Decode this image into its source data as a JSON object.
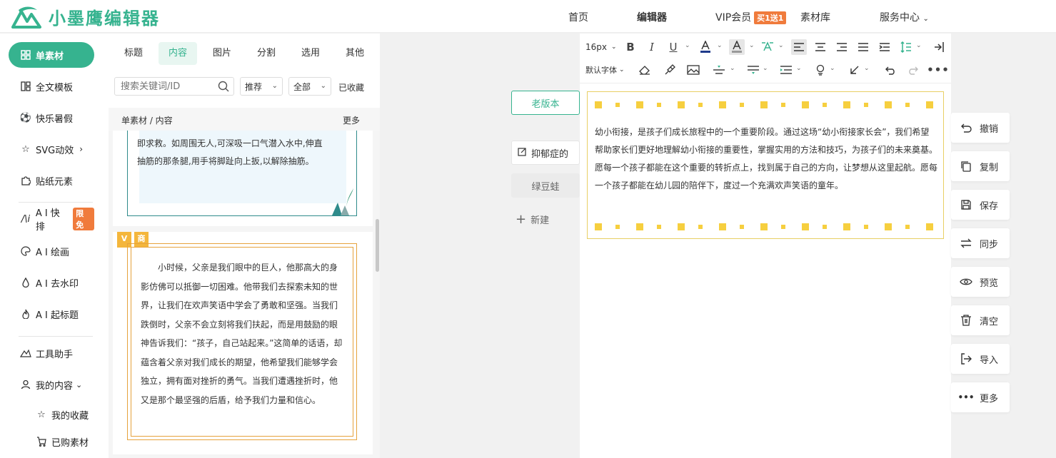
{
  "brand": {
    "name": "小墨鹰编辑器",
    "accent": "#36b38f"
  },
  "nav": {
    "home": "首页",
    "editor": "编辑器",
    "vip": "VIP会员",
    "vip_badge": "买1送1",
    "library": "素材库",
    "service": "服务中心"
  },
  "sidebar": {
    "items": [
      {
        "label": "单素材",
        "icon": "grid-icon"
      },
      {
        "label": "全文模板",
        "icon": "template-icon"
      },
      {
        "label": "快乐暑假",
        "icon": "soccer-ball-icon"
      },
      {
        "label": "SVG动效",
        "icon": "star-icon"
      },
      {
        "label": "贴纸元素",
        "icon": "puzzle-icon"
      },
      {
        "label": "A I 快排",
        "icon": "ai-icon",
        "badge": "限免"
      },
      {
        "label": "A I 绘画",
        "icon": "palette-icon"
      },
      {
        "label": "A I 去水印",
        "icon": "drop-icon"
      },
      {
        "label": "A I 起标题",
        "icon": "flame-icon"
      },
      {
        "label": "工具助手",
        "icon": "tools-icon"
      },
      {
        "label": "我的内容",
        "icon": "user-icon"
      },
      {
        "label": "我的收藏",
        "icon": "star-icon"
      },
      {
        "label": "已购素材",
        "icon": "cart-icon"
      }
    ]
  },
  "panel": {
    "tabs": [
      "标题",
      "内容",
      "图片",
      "分割",
      "选用",
      "其他"
    ],
    "search_placeholder": "搜索关键词/ID",
    "sort": "推荐",
    "filter": "全部",
    "favorites": "已收藏",
    "breadcrumb": "单素材 / 内容",
    "more": "更多",
    "card1_text": "即求救。如周围无人,可深吸一口气潜入水中,伸直抽筋的那条腿,用手将脚趾向上扳,以解除抽筋。",
    "card2_tag1": "V",
    "card2_tag2": "商",
    "card2_text": "小时候，父亲是我们眼中的巨人，他那高大的身影仿佛可以抵御一切困难。他带我们去探索未知的世界，让我们在欢声笑语中学会了勇敢和坚强。当我们跌倒时，父亲不会立刻将我们扶起，而是用鼓励的眼神告诉我们：“孩子，自己站起来。”这简单的话语，却蕴含着父亲对我们成长的期望，他希望我们能够学会独立，拥有面对挫折的勇气。当我们遭遇挫折时，他又是那个最坚强的后盾，给予我们力量和信心。"
  },
  "workspace": {
    "old_version": "老版本",
    "doc1": "抑郁症的",
    "doc2": "绿豆蛙",
    "new_doc": "新建"
  },
  "toolbar": {
    "font_size": "16px",
    "font_family": "默认字体"
  },
  "editor": {
    "text": "幼小衔接，是孩子们成长旅程中的一个重要阶段。通过这场“幼小衔接家长会”，我们希望帮助家长们更好地理解幼小衔接的重要性，掌握实用的方法和技巧，为孩子们的未来奠基。愿每一个孩子都能在这个重要的转折点上，找到属于自己的方向，让梦想从这里起航。愿每一个孩子都能在幼儿园的陪伴下，度过一个充满欢声笑语的童年。",
    "dot_color": "#f6cf3f"
  },
  "actions": [
    {
      "label": "撤销",
      "icon": "undo-icon"
    },
    {
      "label": "复制",
      "icon": "copy-icon"
    },
    {
      "label": "保存",
      "icon": "save-icon"
    },
    {
      "label": "同步",
      "icon": "sync-icon"
    },
    {
      "label": "预览",
      "icon": "eye-icon"
    },
    {
      "label": "清空",
      "icon": "trash-icon"
    },
    {
      "label": "导入",
      "icon": "import-icon"
    },
    {
      "label": "更多",
      "icon": "more-icon"
    }
  ]
}
